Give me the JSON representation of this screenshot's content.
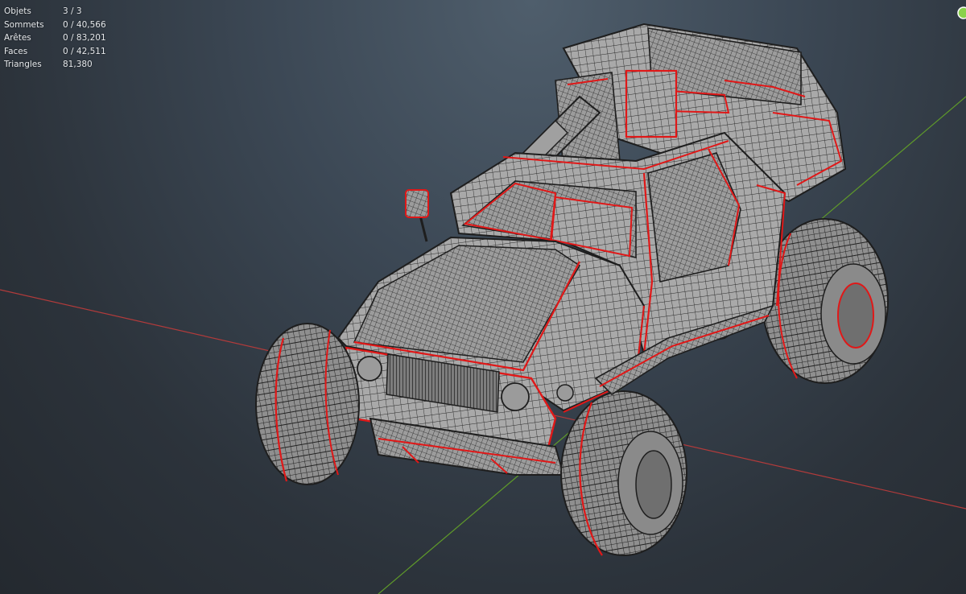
{
  "stats": [
    {
      "label": "Objets",
      "value": "3 / 3"
    },
    {
      "label": "Sommets",
      "value": "0 / 40,566"
    },
    {
      "label": "Arêtes",
      "value": "0 / 83,201"
    },
    {
      "label": "Faces",
      "value": "0 / 42,511"
    },
    {
      "label": "Triangles",
      "value": "81,380"
    }
  ],
  "colors": {
    "x_axis": "#b23b3b",
    "y_axis": "#5f9a2a",
    "mesh_fill": "#a6a6a6",
    "wire": "#2a2a2a",
    "seam": "#e01818",
    "gizmo": "#8ad14a"
  }
}
